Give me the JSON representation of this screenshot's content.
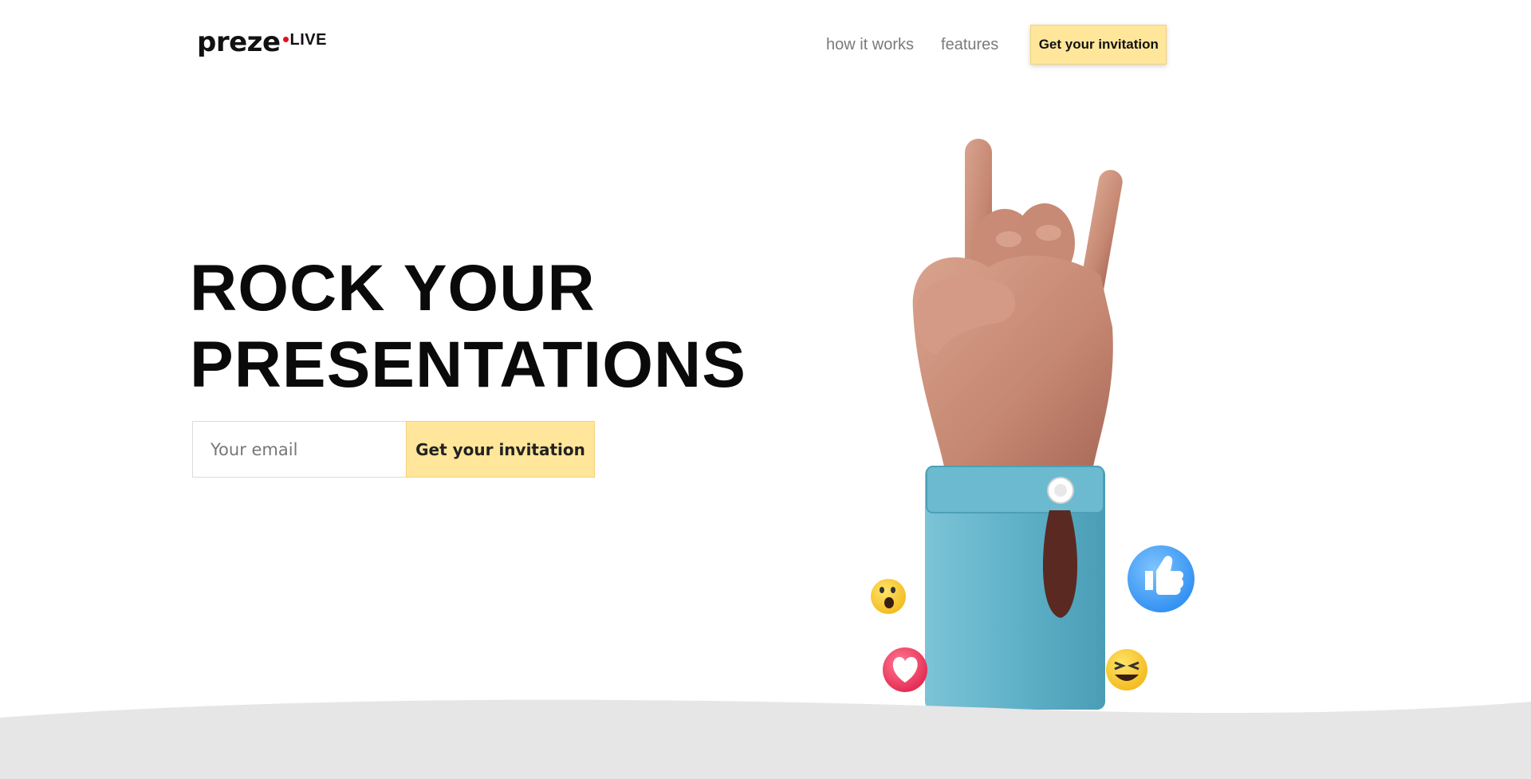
{
  "header": {
    "logo": {
      "brand": "preze",
      "suffix": "LIVE"
    },
    "nav": {
      "how_it_works": "how it works",
      "features": "features",
      "cta": "Get your invitation"
    }
  },
  "hero": {
    "title_line1": "ROCK YOUR",
    "title_line2": "PRESENTATIONS",
    "email_placeholder": "Your email",
    "cta": "Get your invitation"
  },
  "illustration": {
    "subject": "rock-on-hand",
    "reactions": [
      "wow-emoji-icon",
      "thumbs-up-icon",
      "heart-icon",
      "laughing-emoji-icon"
    ]
  },
  "colors": {
    "accent": "#ffe69a",
    "logo_dot": "#e0121f",
    "text": "#0a0a0a",
    "nav_text": "#7a7a7a",
    "footer_band": "#e6e6e6"
  }
}
